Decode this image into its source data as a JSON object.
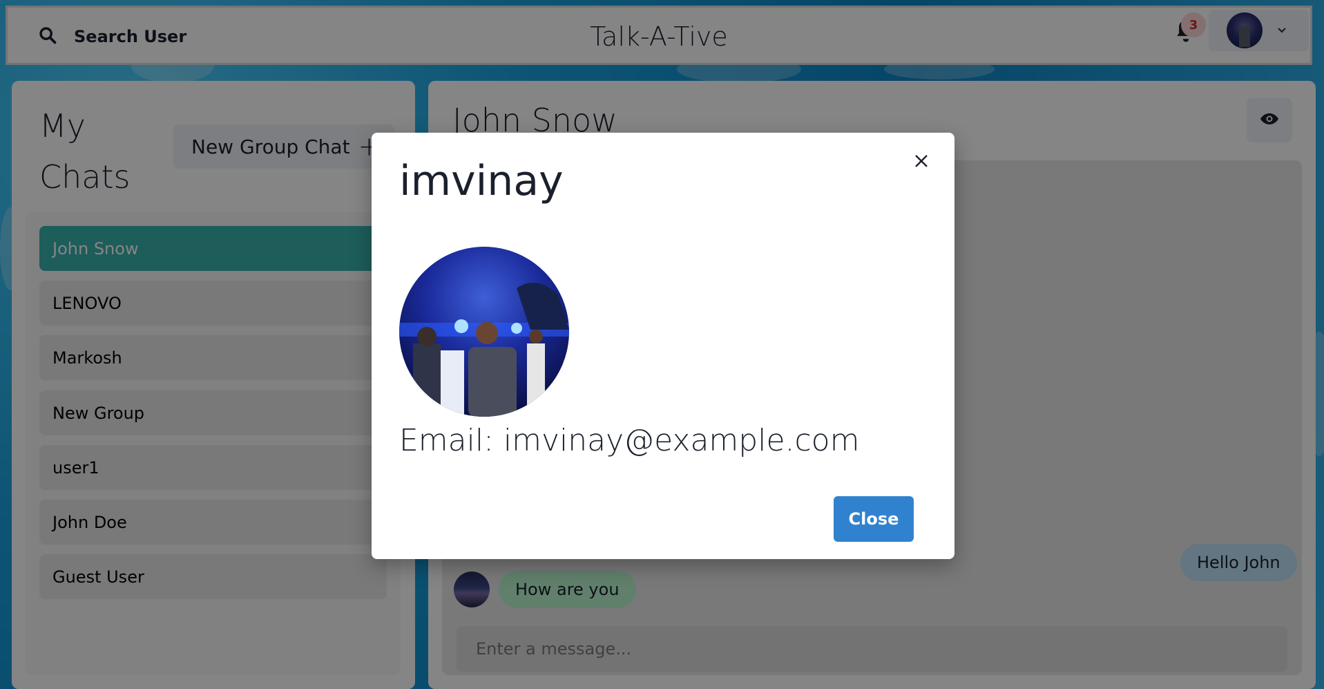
{
  "header": {
    "search_label": "Search User",
    "app_title": "Talk-A-Tive",
    "notification_count": "3"
  },
  "sidebar": {
    "title": "My Chats",
    "new_group_label": "New Group Chat",
    "new_group_icon": "+",
    "chats": [
      {
        "name": "John Snow",
        "active": true
      },
      {
        "name": "LENOVO",
        "active": false
      },
      {
        "name": "Markosh",
        "active": false
      },
      {
        "name": "New Group",
        "active": false
      },
      {
        "name": "user1",
        "active": false
      },
      {
        "name": "John Doe",
        "active": false
      },
      {
        "name": "Guest User",
        "active": false
      }
    ]
  },
  "chat": {
    "title": "John Snow",
    "messages": [
      {
        "text": "Hello John",
        "sender": "self"
      },
      {
        "text": "How are you",
        "sender": "other"
      }
    ],
    "input_placeholder": "Enter a message..."
  },
  "modal": {
    "title": "imvinay",
    "email_line": "Email: imvinay@example.com",
    "close_button": "Close"
  },
  "colors": {
    "accent": "#38b2ac",
    "primary_button": "#3182ce",
    "sent_bubble": "#bee3f8",
    "received_bubble": "#b9f5d0",
    "badge_text": "#c53030"
  },
  "icons": {
    "search": "search-icon",
    "bell": "bell-icon",
    "chevron": "chevron-down-icon",
    "eye": "eye-icon",
    "close": "close-icon",
    "plus": "plus-icon"
  }
}
